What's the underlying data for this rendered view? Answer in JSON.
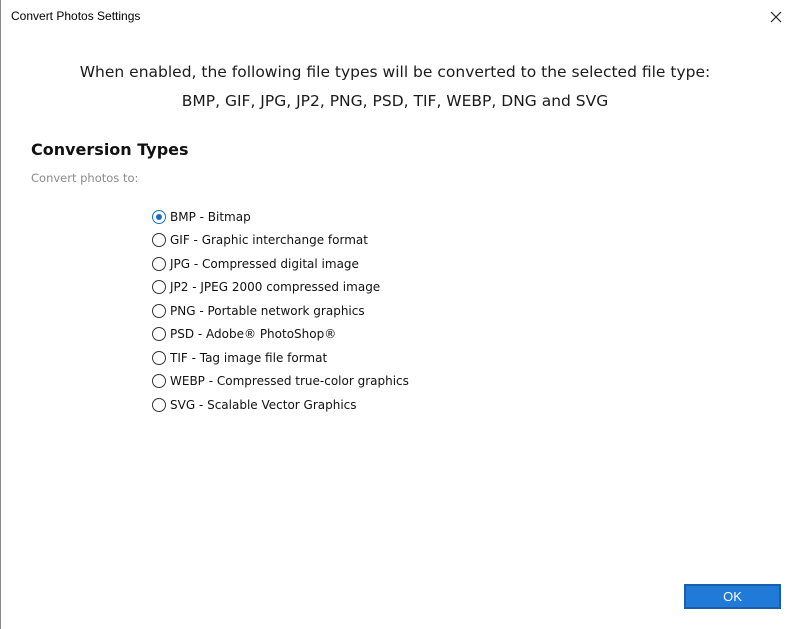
{
  "window": {
    "title": "Convert Photos Settings",
    "close_icon": "close-icon"
  },
  "intro": {
    "line1": "When enabled, the following file types will be converted to the selected file type:",
    "line2": "BMP, GIF, JPG, JP2, PNG, PSD, TIF, WEBP, DNG and SVG"
  },
  "section": {
    "title": "Conversion Types",
    "subtitle": "Convert photos to:"
  },
  "options": [
    {
      "label": "BMP - Bitmap",
      "checked": true
    },
    {
      "label": "GIF - Graphic interchange format",
      "checked": false
    },
    {
      "label": "JPG - Compressed digital image",
      "checked": false
    },
    {
      "label": "JP2 - JPEG 2000 compressed image",
      "checked": false
    },
    {
      "label": "PNG - Portable network graphics",
      "checked": false
    },
    {
      "label": "PSD - Adobe® PhotoShop®",
      "checked": false
    },
    {
      "label": "TIF - Tag image file format",
      "checked": false
    },
    {
      "label": "WEBP - Compressed true-color graphics",
      "checked": false
    },
    {
      "label": "SVG - Scalable Vector Graphics",
      "checked": false
    }
  ],
  "footer": {
    "ok_label": "OK"
  },
  "colors": {
    "accent": "#1f7ad8",
    "radio_selected": "#1a6fc4",
    "subtitle_text": "#8a8a8a"
  }
}
